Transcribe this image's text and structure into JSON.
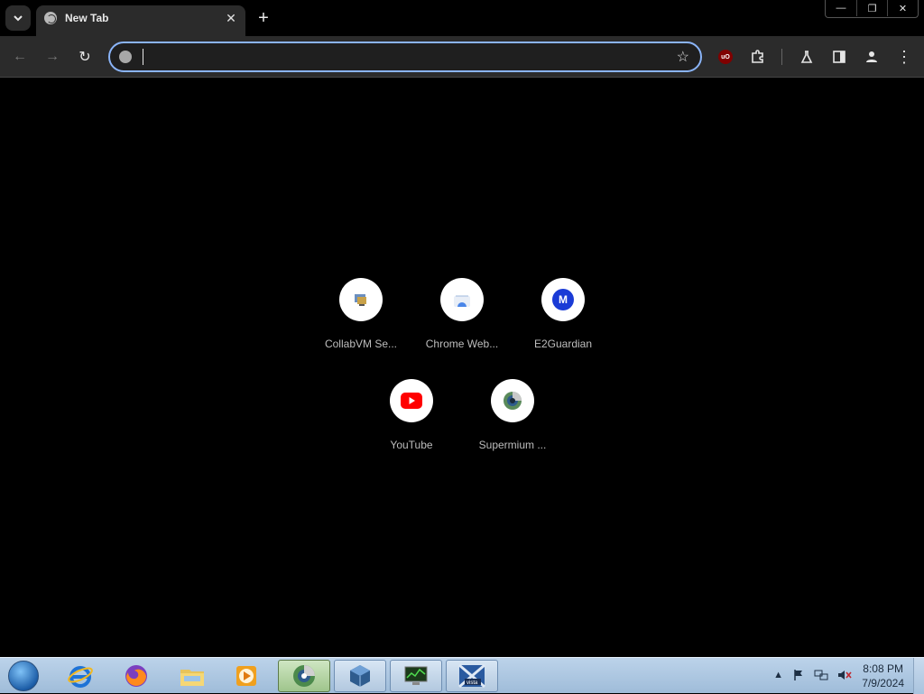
{
  "browser": {
    "tab": {
      "title": "New Tab",
      "close_glyph": "✕"
    },
    "new_tab_glyph": "+",
    "window_controls": {
      "minimize": "—",
      "restore": "❐",
      "close": "✕"
    },
    "toolbar": {
      "back_glyph": "←",
      "forward_glyph": "→",
      "reload_glyph": "↻",
      "omnibox_value": "",
      "bookmark_glyph": "☆",
      "ublock_label": "uO",
      "menu_glyph": "⋮"
    }
  },
  "shortcuts": [
    {
      "label": "CollabVM Se..."
    },
    {
      "label": "Chrome Web..."
    },
    {
      "label": "E2Guardian",
      "icon_letter": "M"
    },
    {
      "label": "YouTube"
    },
    {
      "label": "Supermium ..."
    }
  ],
  "taskbar": {
    "clock_time": "8:08 PM",
    "clock_date": "7/9/2024"
  },
  "colors": {
    "accent": "#8ab4f8",
    "youtube": "#ff0000",
    "e2guardian": "#1a3bd6",
    "toolbar": "#2b2b2b"
  }
}
